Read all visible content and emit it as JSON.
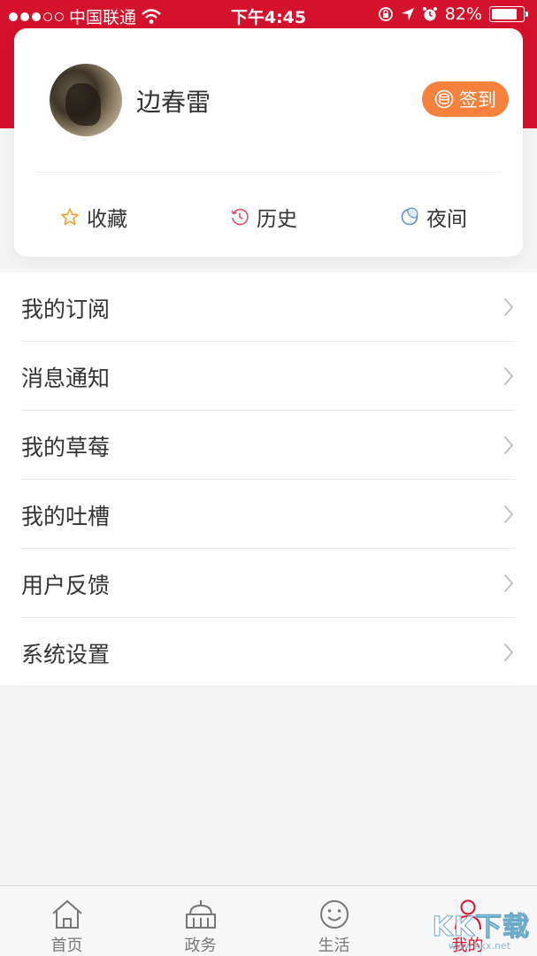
{
  "status_bar": {
    "carrier": "中国联通",
    "time": "下午4:45",
    "battery": "82%",
    "battery_level": 0.82
  },
  "profile": {
    "username": "边春雷",
    "signin_label": "签到"
  },
  "quick_actions": [
    {
      "label": "收藏",
      "icon": "star-icon"
    },
    {
      "label": "历史",
      "icon": "clock-icon"
    },
    {
      "label": "夜间",
      "icon": "moon-icon"
    }
  ],
  "menu": [
    {
      "label": "我的订阅"
    },
    {
      "label": "消息通知"
    },
    {
      "label": "我的草莓"
    },
    {
      "label": "我的吐槽"
    },
    {
      "label": "用户反馈"
    },
    {
      "label": "系统设置"
    }
  ],
  "tabbar": [
    {
      "label": "首页",
      "icon": "home-icon"
    },
    {
      "label": "政务",
      "icon": "government-icon"
    },
    {
      "label": "生活",
      "icon": "smile-icon"
    },
    {
      "label": "我的",
      "icon": "user-icon",
      "active": true
    }
  ],
  "watermark": {
    "text": "KK下载",
    "sub": "www.kkx.net"
  },
  "colors": {
    "brand_red": "#d5122b",
    "signin_orange": "#f6813d",
    "star": "#f0a030",
    "history": "#e0506a",
    "night": "#5b8fd6"
  }
}
